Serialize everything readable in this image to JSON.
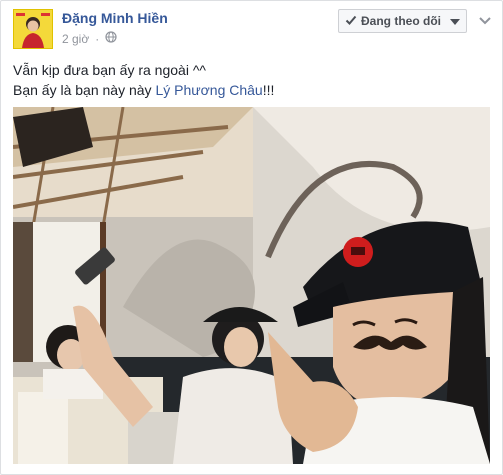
{
  "post": {
    "author": "Đặng Minh Hiền",
    "time": "2 giờ",
    "follow_label": "Đang theo dõi",
    "line1": "Vẫn kịp đưa bạn ấy ra ngoài ^^",
    "line2_prefix": "Bạn ấy là bạn này này ",
    "mention": "Lý Phương Châu",
    "line2_suffix": "!!!"
  },
  "icons": {
    "follow": "check-icon",
    "privacy": "globe-icon",
    "menu": "chevron-down-icon"
  },
  "colors": {
    "link": "#365899",
    "meta": "#90949c",
    "text": "#1d2129"
  }
}
